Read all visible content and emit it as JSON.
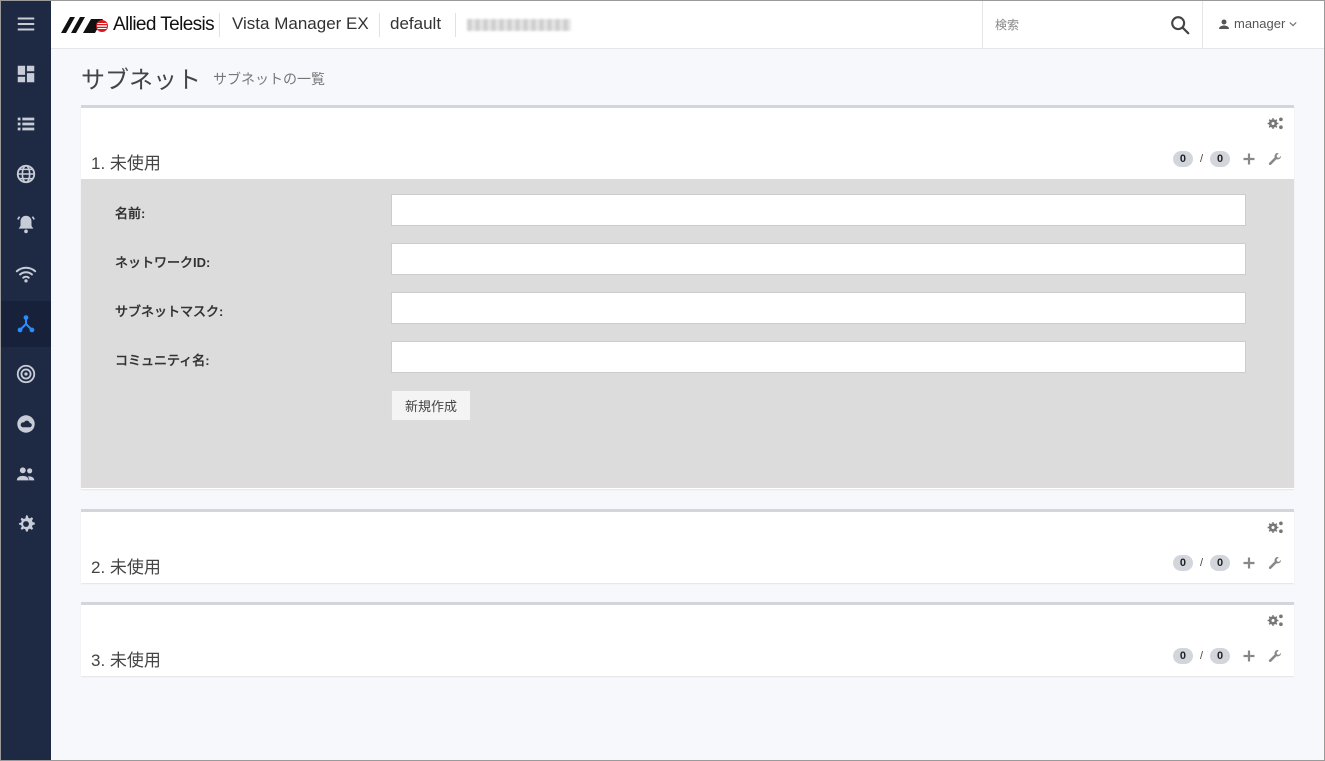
{
  "app": {
    "brand": "Allied Telesis",
    "product": "Vista Manager EX",
    "context": "default",
    "accent": "#2b8cff",
    "sidebar_bg": "#1e2a44"
  },
  "search": {
    "placeholder": "検索"
  },
  "user": {
    "name": "manager"
  },
  "sidebar": {
    "items": [
      {
        "icon": "menu-icon",
        "active": false
      },
      {
        "icon": "dashboard-icon",
        "active": false
      },
      {
        "icon": "list-icon",
        "active": false
      },
      {
        "icon": "globe-icon",
        "active": false
      },
      {
        "icon": "alarm-icon",
        "active": false
      },
      {
        "icon": "wifi-icon",
        "active": false
      },
      {
        "icon": "network-icon",
        "active": true
      },
      {
        "icon": "radar-icon",
        "active": false
      },
      {
        "icon": "cloud-icon",
        "active": false
      },
      {
        "icon": "users-icon",
        "active": false
      },
      {
        "icon": "settings-icon",
        "active": false
      }
    ]
  },
  "page": {
    "title": "サブネット",
    "subtitle": "サブネットの一覧"
  },
  "panels": [
    {
      "title": "1. 未使用",
      "used": "0",
      "total": "0",
      "slash": "/",
      "expanded": true,
      "form": {
        "name_label": "名前:",
        "network_id_label": "ネットワークID:",
        "subnet_mask_label": "サブネットマスク:",
        "community_label": "コミュニティ名:",
        "name_value": "",
        "network_id_value": "",
        "subnet_mask_value": "",
        "community_value": "",
        "create_label": "新規作成"
      }
    },
    {
      "title": "2. 未使用",
      "used": "0",
      "total": "0",
      "slash": "/",
      "expanded": false
    },
    {
      "title": "3. 未使用",
      "used": "0",
      "total": "0",
      "slash": "/",
      "expanded": false
    }
  ]
}
